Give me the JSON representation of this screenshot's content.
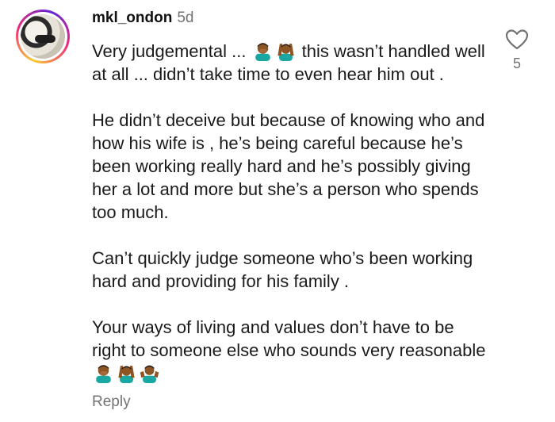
{
  "comment": {
    "username": "mkl_ondon",
    "time": "5d",
    "para1_a": "Very judgemental ... ",
    "para1_b": " this wasn’t handled well at all ... didn’t take time to even hear him out .",
    "para2": "He didn’t deceive but because of knowing who and how his wife is , he’s being careful because he’s been working really hard and he’s possibly giving her a lot and more but she’s a person who spends too much.",
    "para3": "Can’t quickly judge someone who’s been working hard and providing for his family .",
    "para4": "Your ways of living and values don’t have to be right to someone else who sounds very reasonable ",
    "reply_label": "Reply",
    "like_count": "5"
  },
  "icons": {
    "emoji1": "man-facepalming-emoji",
    "emoji2": "man-gesturing-ok-emoji",
    "emoji3": "man-gesturing-ok-emoji",
    "emoji4": "man-shrugging-emoji",
    "heart": "heart-outline-icon"
  },
  "colors": {
    "text": "#1a1a1a",
    "muted": "#737373",
    "skin": "#8d5524",
    "shirt": "#1aa7a1",
    "hair": "#2b1d14"
  }
}
